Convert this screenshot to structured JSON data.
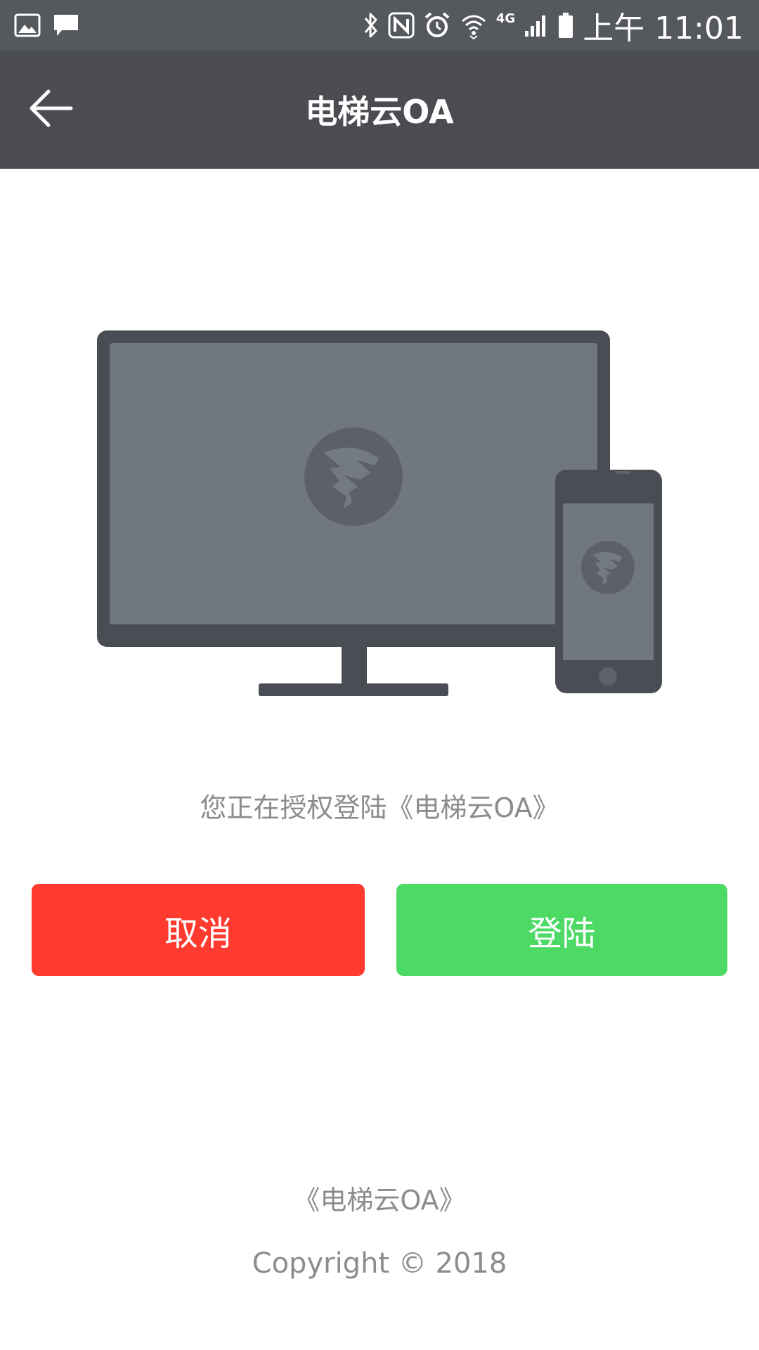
{
  "status_bar": {
    "icons_left": [
      "image-notification-icon",
      "message-notification-icon"
    ],
    "icons_right": [
      "bluetooth-icon",
      "nfc-icon",
      "alarm-icon",
      "wifi-icon",
      "signal-icon",
      "battery-icon"
    ],
    "network": "4G",
    "time": "上午 11:01"
  },
  "header": {
    "title": "电梯云OA",
    "back_icon": "back-arrow-icon"
  },
  "illustration": {
    "icon": "desktop-and-phone-login-illustration"
  },
  "main": {
    "prompt": "您正在授权登陆《电梯云OA》",
    "cancel_label": "取消",
    "login_label": "登陆"
  },
  "footer": {
    "app_name": "《电梯云OA》",
    "copyright": "Copyright © 2018"
  },
  "colors": {
    "status_bar": "#55585d",
    "title_bar": "#4a4c51",
    "cancel_button": "#ff3b30",
    "login_button": "#4cd964",
    "muted_text": "#8a8c90",
    "device_frame": "#4a4e54",
    "device_screen": "#717780"
  }
}
